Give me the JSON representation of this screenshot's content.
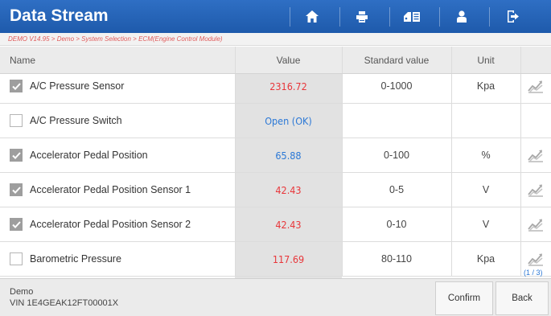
{
  "header": {
    "title": "Data Stream",
    "buttons": [
      {
        "name": "home-icon"
      },
      {
        "name": "printer-icon"
      },
      {
        "name": "report-icon"
      },
      {
        "name": "user-icon"
      },
      {
        "name": "exit-icon"
      }
    ]
  },
  "breadcrumb": "DEMO V14.95 > Demo > System Selection > ECM(Engine Control Module)",
  "table": {
    "columns": {
      "name": "Name",
      "value": "Value",
      "standard": "Standard value",
      "unit": "Unit"
    },
    "rows": [
      {
        "name": "A/C Pressure Sensor",
        "checked": true,
        "value": "2316.72",
        "value_color": "red",
        "standard": "0-1000",
        "unit": "Kpa",
        "graph": true
      },
      {
        "name": "A/C Pressure Switch",
        "checked": false,
        "value": "Open (OK)",
        "value_color": "blue",
        "standard": "",
        "unit": "",
        "graph": false
      },
      {
        "name": "Accelerator Pedal Position",
        "checked": true,
        "value": "65.88",
        "value_color": "blue",
        "standard": "0-100",
        "unit": "%",
        "graph": true
      },
      {
        "name": "Accelerator Pedal Position Sensor 1",
        "checked": true,
        "value": "42.43",
        "value_color": "red",
        "standard": "0-5",
        "unit": "V",
        "graph": true
      },
      {
        "name": "Accelerator Pedal Position Sensor 2",
        "checked": true,
        "value": "42.43",
        "value_color": "red",
        "standard": "0-10",
        "unit": "V",
        "graph": true
      },
      {
        "name": "Barometric Pressure",
        "checked": false,
        "value": "117.69",
        "value_color": "red",
        "standard": "80-110",
        "unit": "Kpa",
        "graph": true
      }
    ]
  },
  "page_indicator": "(1 / 3)",
  "footer": {
    "vehicle": "Demo",
    "vin": "VIN 1E4GEAK12FT00001X",
    "confirm_label": "Confirm",
    "back_label": "Back"
  },
  "colors": {
    "header_bg": "#2566bb",
    "value_red": "#e8363a",
    "value_blue": "#2b78d6",
    "breadcrumb_text": "#e05a5a"
  }
}
